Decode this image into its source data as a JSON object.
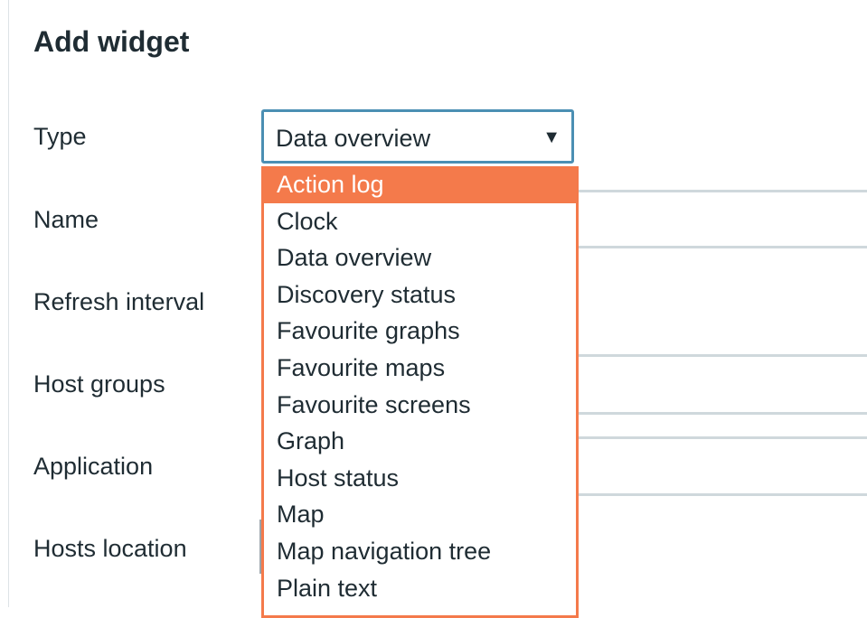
{
  "dialog": {
    "title": "Add widget"
  },
  "form": {
    "labels": {
      "type": "Type",
      "name": "Name",
      "refresh_interval": "Refresh interval",
      "host_groups": "Host groups",
      "application": "Application",
      "hosts_location": "Hosts location"
    },
    "type_select": {
      "value": "Data overview",
      "caret": "▼"
    }
  },
  "dropdown": {
    "options": [
      {
        "label": "Action log",
        "highlighted": true
      },
      {
        "label": "Clock"
      },
      {
        "label": "Data overview"
      },
      {
        "label": "Discovery status"
      },
      {
        "label": "Favourite graphs"
      },
      {
        "label": "Favourite maps"
      },
      {
        "label": "Favourite screens"
      },
      {
        "label": "Graph"
      },
      {
        "label": "Host status"
      },
      {
        "label": "Map"
      },
      {
        "label": "Map navigation tree"
      },
      {
        "label": "Plain text"
      }
    ]
  },
  "colors": {
    "highlight": "#f47a4b",
    "select_border": "#4b8fb3",
    "text": "#1f2c33",
    "field_border": "#cfd8dc"
  }
}
